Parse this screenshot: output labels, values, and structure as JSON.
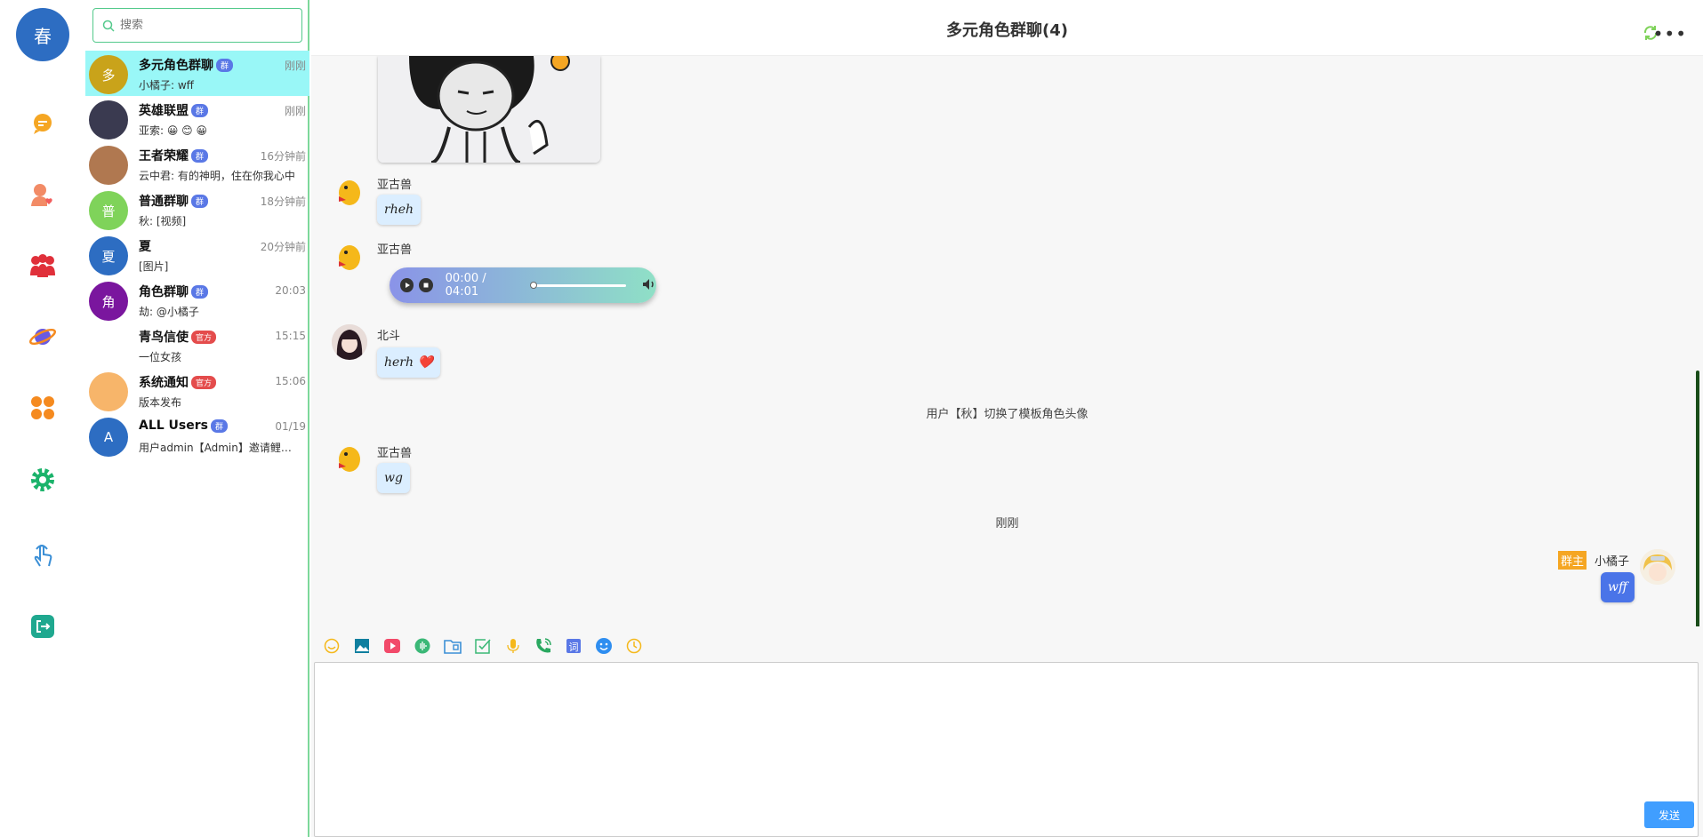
{
  "user": {
    "avatar_char": "春"
  },
  "nav": {
    "items": [
      {
        "icon": "chat-icon",
        "color": "#f5a623"
      },
      {
        "icon": "friend-icon",
        "color": "#f28b66"
      },
      {
        "icon": "group-icon",
        "color": "#e0303a"
      },
      {
        "icon": "planet-icon",
        "color": "#6a5ae0"
      },
      {
        "icon": "apps-icon",
        "color": "#f58a1f"
      },
      {
        "icon": "settings-icon",
        "color": "#1bb36b"
      },
      {
        "icon": "touch-icon",
        "color": "#3b8fd6"
      },
      {
        "icon": "logout-icon",
        "color": "#1fa88f"
      }
    ]
  },
  "search": {
    "placeholder": "搜索"
  },
  "conversations": [
    {
      "avatar": "多",
      "avatar_color": "#c9a31a",
      "name": "多元角色群聊",
      "tag": "群",
      "tag_type": "grp",
      "time": "刚刚",
      "preview": "小橘子: wff",
      "active": true
    },
    {
      "avatar": "",
      "avatar_color": "#3a3a50",
      "name": "英雄联盟",
      "tag": "群",
      "tag_type": "grp",
      "time": "刚刚",
      "preview": "亚索: 😀 😊 😀",
      "active": false
    },
    {
      "avatar": "",
      "avatar_color": "#b07850",
      "name": "王者荣耀",
      "tag": "群",
      "tag_type": "grp",
      "time": "16分钟前",
      "preview": "云中君: 有的神明，住在你我心中",
      "active": false
    },
    {
      "avatar": "普",
      "avatar_color": "#7fd35a",
      "name": "普通群聊",
      "tag": "群",
      "tag_type": "grp",
      "time": "18分钟前",
      "preview": "秋: [视频]",
      "active": false
    },
    {
      "avatar": "夏",
      "avatar_color": "#2d6dc2",
      "name": "夏",
      "tag": "",
      "tag_type": "",
      "time": "20分钟前",
      "preview": "[图片]",
      "active": false
    },
    {
      "avatar": "角",
      "avatar_color": "#7a169e",
      "name": "角色群聊",
      "tag": "群",
      "tag_type": "grp",
      "time": "20:03",
      "preview": "劫: @小橘子",
      "active": false
    },
    {
      "avatar": "",
      "avatar_color": "#ffffff",
      "name": "青鸟信使",
      "tag": "官方",
      "tag_type": "off",
      "time": "15:15",
      "preview": "一位女孩",
      "active": false
    },
    {
      "avatar": "",
      "avatar_color": "#f7b56a",
      "name": "系统通知",
      "tag": "官方",
      "tag_type": "off",
      "time": "15:06",
      "preview": "版本发布",
      "active": false
    },
    {
      "avatar": "A",
      "avatar_color": "#2d6dc2",
      "name": "ALL Users",
      "tag": "群",
      "tag_type": "grp",
      "time": "01/19",
      "preview": "用户admin【Admin】邀请鲤鱼加入群聊",
      "active": false
    }
  ],
  "chat": {
    "title": "多元角色群聊(4)",
    "messages": {
      "m1_sender": "亚古兽",
      "m1_text": "rheh",
      "m2_sender": "亚古兽",
      "m2_time": "00:00 / 04:01",
      "m3_sender": "北斗",
      "m3_text": "herh ❤️",
      "sys1": "用户【秋】切换了模板角色头像",
      "m4_sender": "亚古兽",
      "m4_text": "wg",
      "time_divider": "刚刚",
      "m5_tag": "群主",
      "m5_sender": "小橘子",
      "m5_text": "wff"
    },
    "toolbar": [
      "emoji-icon",
      "image-icon",
      "video-icon",
      "audio-icon",
      "file-icon",
      "task-icon",
      "mic-icon",
      "call-icon",
      "word-icon",
      "face-icon",
      "clock-icon"
    ],
    "send_label": "发送"
  }
}
